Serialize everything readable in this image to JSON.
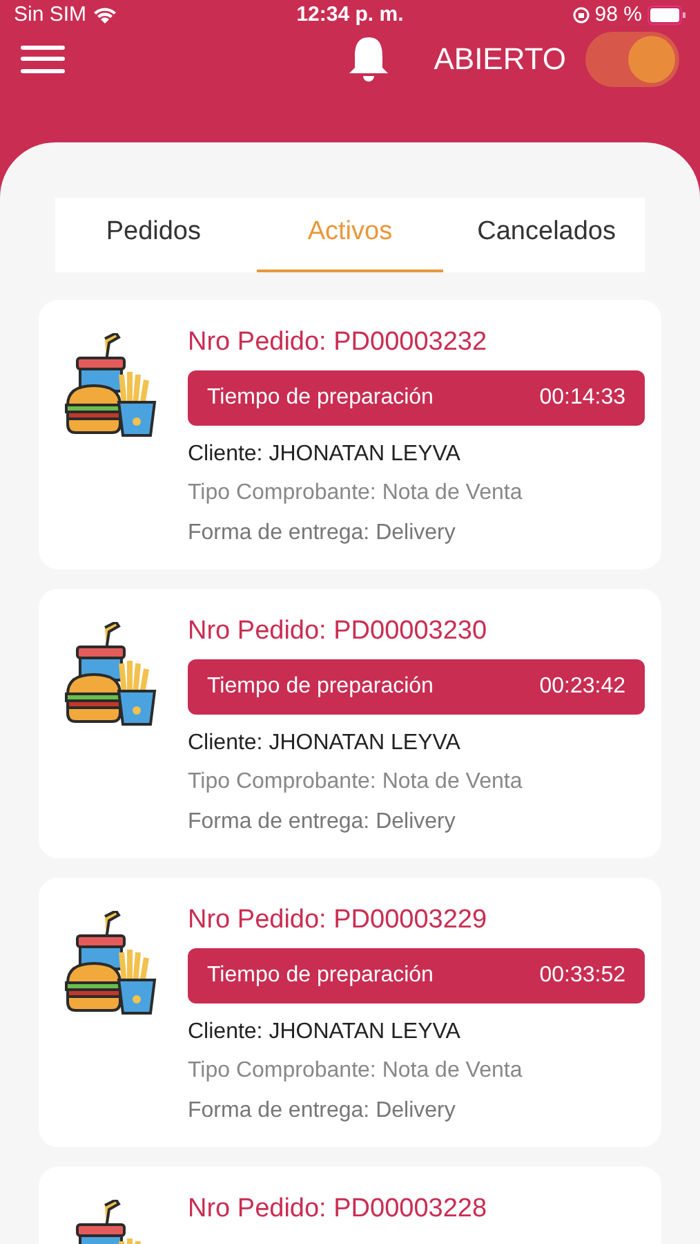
{
  "status_bar": {
    "carrier": "Sin SIM",
    "time": "12:34 p. m.",
    "battery": "98 %"
  },
  "header": {
    "status_label": "ABIERTO",
    "open": true
  },
  "tabs": [
    {
      "label": "Pedidos",
      "selected": false
    },
    {
      "label": "Activos",
      "selected": true
    },
    {
      "label": "Cancelados",
      "selected": false
    }
  ],
  "orders": [
    {
      "order_no": "Nro Pedido: PD00003232",
      "timer_label": "Tiempo de preparación",
      "timer": "00:14:33",
      "client": "Cliente: JHONATAN LEYVA",
      "receipt_type": "Tipo Comprobante: Nota de Venta",
      "delivery": "Forma de entrega: Delivery"
    },
    {
      "order_no": "Nro Pedido: PD00003230",
      "timer_label": "Tiempo de preparación",
      "timer": "00:23:42",
      "client": "Cliente: JHONATAN LEYVA",
      "receipt_type": "Tipo Comprobante: Nota de Venta",
      "delivery": "Forma de entrega: Delivery"
    },
    {
      "order_no": "Nro Pedido: PD00003229",
      "timer_label": "Tiempo de preparación",
      "timer": "00:33:52",
      "client": "Cliente: JHONATAN LEYVA",
      "receipt_type": "Tipo Comprobante: Nota de Venta",
      "delivery": "Forma de entrega: Delivery"
    },
    {
      "order_no": "Nro Pedido: PD00003228"
    }
  ]
}
